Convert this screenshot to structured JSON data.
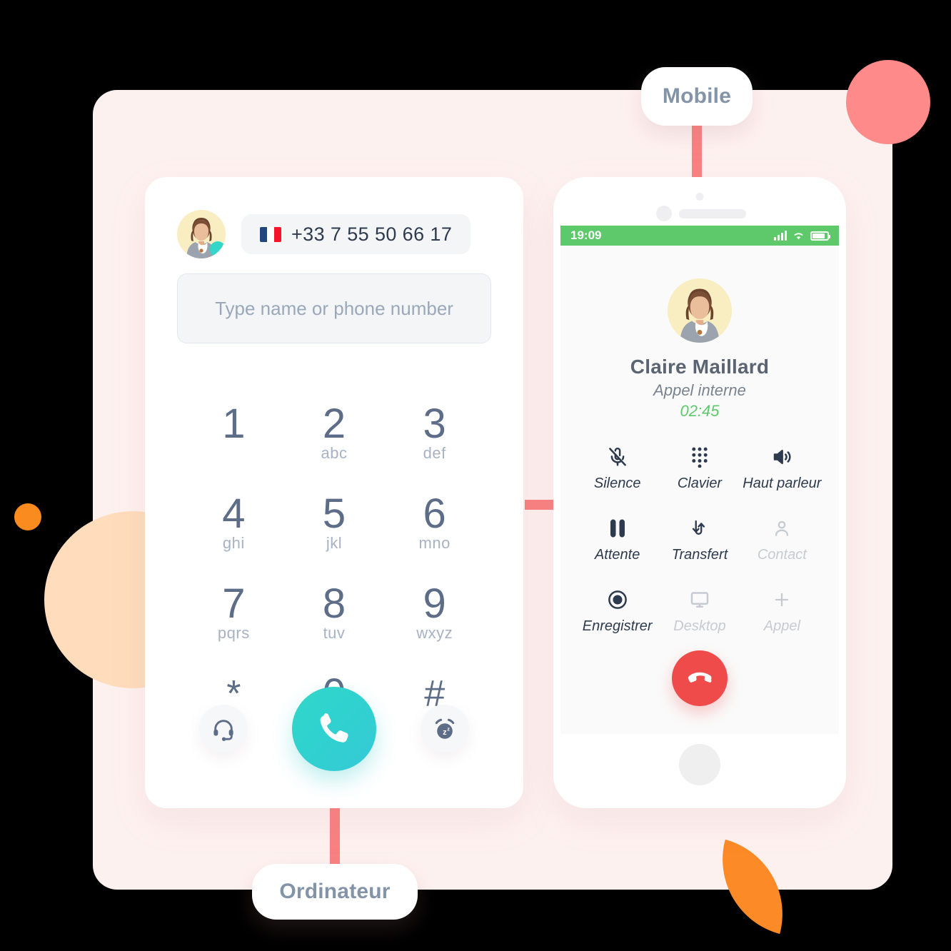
{
  "labels": {
    "mobile": "Mobile",
    "ordinateur": "Ordinateur"
  },
  "desktop": {
    "phone_number": "+33 7 55 50 66 17",
    "flag": "france-flag",
    "avatar_icon": "user-avatar",
    "presence": "online",
    "search_placeholder": "Type name or phone number",
    "search_value": "",
    "keys": [
      {
        "digit": "1",
        "letters": ""
      },
      {
        "digit": "2",
        "letters": "abc"
      },
      {
        "digit": "3",
        "letters": "def"
      },
      {
        "digit": "4",
        "letters": "ghi"
      },
      {
        "digit": "5",
        "letters": "jkl"
      },
      {
        "digit": "6",
        "letters": "mno"
      },
      {
        "digit": "7",
        "letters": "pqrs"
      },
      {
        "digit": "8",
        "letters": "tuv"
      },
      {
        "digit": "9",
        "letters": "wxyz"
      },
      {
        "digit": "*",
        "letters": ""
      },
      {
        "digit": "0",
        "letters": "+"
      },
      {
        "digit": "#",
        "letters": ""
      }
    ],
    "actions": {
      "headset": "headset-icon",
      "call": "call-icon",
      "dnd": "do-not-disturb-icon"
    }
  },
  "mobile": {
    "statusbar": {
      "time": "19:09",
      "signal": "signal-icon",
      "wifi": "wifi-icon",
      "battery": "battery-icon"
    },
    "call": {
      "name": "Claire Maillard",
      "type": "Appel interne",
      "duration": "02:45",
      "avatar_icon": "user-avatar"
    },
    "controls": [
      {
        "label": "Silence",
        "icon": "mic-muted-icon",
        "disabled": false
      },
      {
        "label": "Clavier",
        "icon": "keypad-icon",
        "disabled": false
      },
      {
        "label": "Haut parleur",
        "icon": "speaker-icon",
        "disabled": false
      },
      {
        "label": "Attente",
        "icon": "pause-icon",
        "disabled": false
      },
      {
        "label": "Transfert",
        "icon": "transfer-icon",
        "disabled": false
      },
      {
        "label": "Contact",
        "icon": "person-icon",
        "disabled": true
      },
      {
        "label": "Enregistrer",
        "icon": "record-icon",
        "disabled": false
      },
      {
        "label": "Desktop",
        "icon": "monitor-icon",
        "disabled": true
      },
      {
        "label": "Appel",
        "icon": "plus-icon",
        "disabled": true
      }
    ],
    "end_call": "end-call-icon"
  },
  "colors": {
    "panel": "#FDF1F0",
    "accent_salmon": "#F98080",
    "accent_teal": "#33D6C8",
    "accent_green": "#5DC96A",
    "accent_red": "#EF4B4B",
    "accent_orange": "#FC8A27",
    "text_dark": "#2E3A4D",
    "text_muted": "#A7B2C2"
  }
}
